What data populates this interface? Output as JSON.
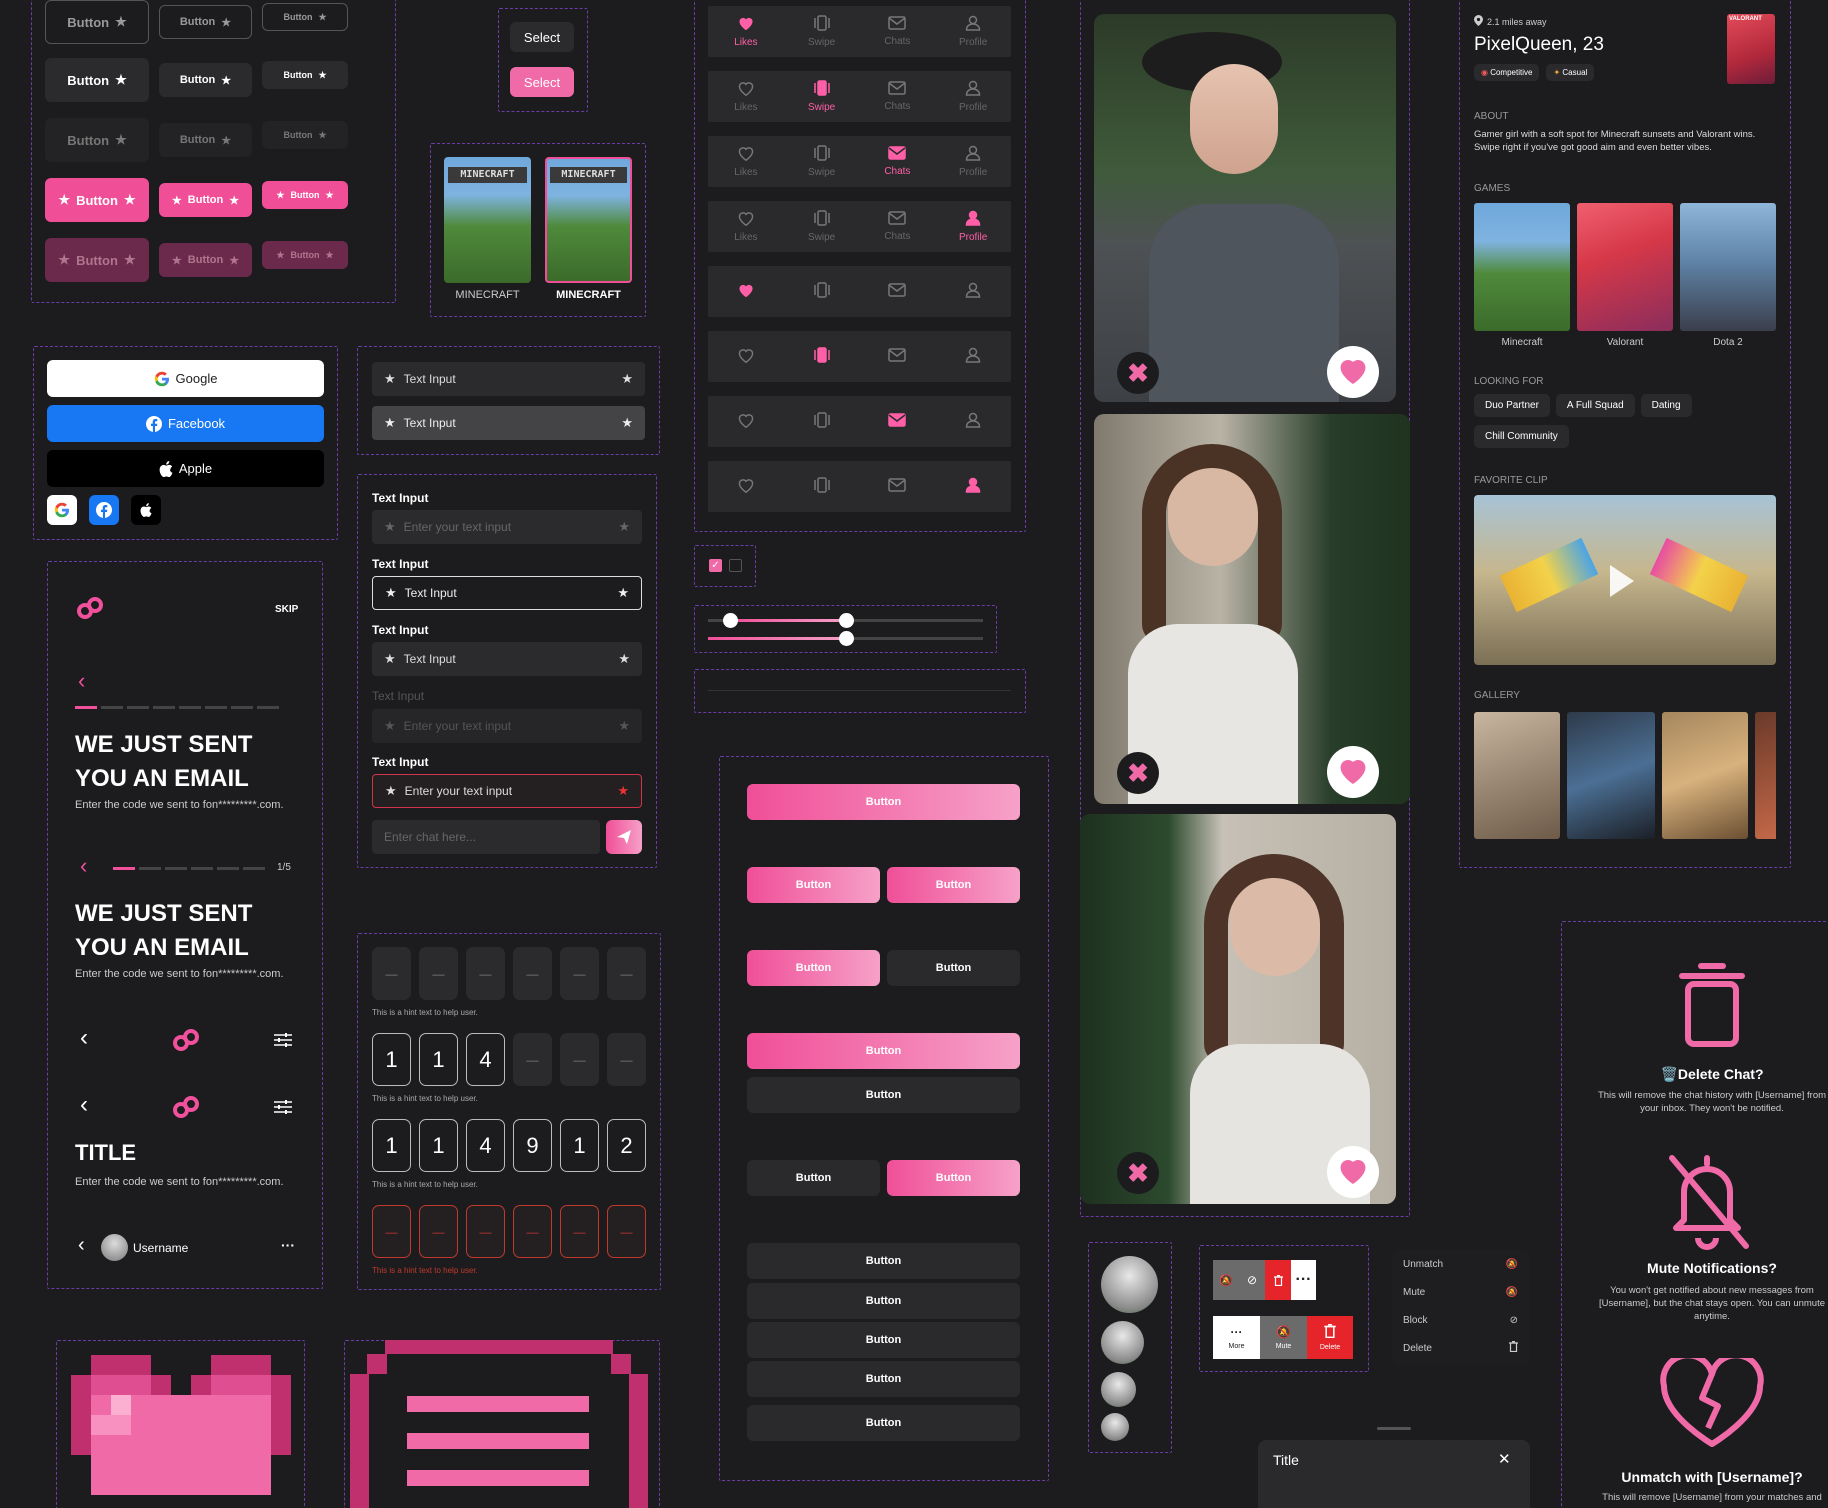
{
  "buttons_grid": {
    "label": "Button"
  },
  "select": {
    "default": "Select",
    "active": "Select"
  },
  "game_cards": [
    {
      "label": "MINECRAFT"
    },
    {
      "label": "MINECRAFT"
    }
  ],
  "social": {
    "google": "Google",
    "facebook": "Facebook",
    "apple": "Apple"
  },
  "text_inputs": {
    "field_label": "Text Input",
    "value": "Text Input",
    "placeholder": "Enter your text input",
    "chat_placeholder": "Enter chat here..."
  },
  "onboarding": {
    "skip": "SKIP",
    "heading": "WE JUST SENT YOU AN EMAIL",
    "subtitle": "Enter the code we sent to fon*********.com.",
    "step": "1/5",
    "title": "TITLE",
    "username": "Username"
  },
  "otp": {
    "hint": "This is a hint text to help user.",
    "partial": [
      "1",
      "1",
      "4",
      "–",
      "–",
      "–"
    ],
    "full": [
      "1",
      "1",
      "4",
      "9",
      "1",
      "2"
    ],
    "empty": "–"
  },
  "nav": {
    "items": [
      "Likes",
      "Swipe",
      "Chats",
      "Profile"
    ],
    "active_rows": [
      0,
      1,
      2,
      3
    ]
  },
  "slider": {
    "single": 0.5,
    "range": [
      0.08,
      0.5
    ]
  },
  "gradient_buttons": {
    "label": "Button"
  },
  "profile": {
    "distance": "2.1 miles away",
    "name": "PixelQueen, 23",
    "tags": [
      "Competitive",
      "Casual"
    ],
    "about_title": "ABOUT",
    "about": "Gamer girl with a soft spot for Minecraft sunsets and Valorant wins. Swipe right if you've got good aim and even better vibes.",
    "games_title": "GAMES",
    "games": [
      "Minecraft",
      "Valorant",
      "Dota 2"
    ],
    "looking_title": "LOOKING FOR",
    "looking": [
      "Duo Partner",
      "A Full Squad",
      "Dating",
      "Chill Community"
    ],
    "clip_title": "FAVORITE CLIP",
    "gallery_title": "GALLERY",
    "thumb_text": "VALORANT"
  },
  "swipe_actions": {
    "more": "More",
    "mute": "Mute",
    "delete": "Delete"
  },
  "context_menu": [
    {
      "label": "Unmatch",
      "icon": "bell-off-icon"
    },
    {
      "label": "Mute",
      "icon": "bell-off-icon"
    },
    {
      "label": "Block",
      "icon": "block-icon"
    },
    {
      "label": "Delete",
      "icon": "trash-icon"
    }
  ],
  "sheet": {
    "title": "Title"
  },
  "dialogs": [
    {
      "title": "Delete Chat?",
      "body": "This will remove the chat history with [Username] from your inbox. They won't be notified."
    },
    {
      "title": "Mute Notifications?",
      "body": "You won't get notified about new messages from [Username], but the chat stays open. You can unmute anytime."
    },
    {
      "title": "Unmatch with [Username]?",
      "body": "This will remove [Username] from your matches and"
    }
  ],
  "colors": {
    "accent": "#f04f98",
    "accent_light": "#f6a1c8",
    "facebook": "#1877f2",
    "bg": "#1c1c1e"
  }
}
